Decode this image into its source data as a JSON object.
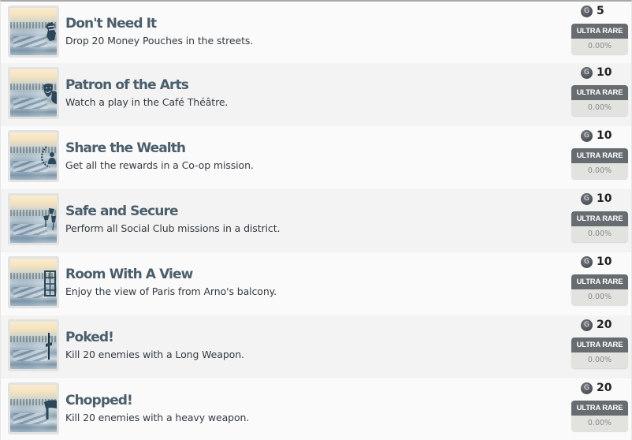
{
  "achievements": [
    {
      "title": "Don't Need It",
      "description": "Drop 20 Money Pouches in the streets.",
      "gamerscore": "5",
      "rarity": "ULTRA RARE",
      "percent": "0.00%",
      "icon": "money-pouch-icon"
    },
    {
      "title": "Patron of the Arts",
      "description": "Watch a play in the Café Théâtre.",
      "gamerscore": "10",
      "rarity": "ULTRA RARE",
      "percent": "0.00%",
      "icon": "theatre-masks-icon"
    },
    {
      "title": "Share the Wealth",
      "description": "Get all the rewards in a Co-op mission.",
      "gamerscore": "10",
      "rarity": "ULTRA RARE",
      "percent": "0.00%",
      "icon": "laurel-figure-icon"
    },
    {
      "title": "Safe and Secure",
      "description": "Perform all Social Club missions in a district.",
      "gamerscore": "10",
      "rarity": "ULTRA RARE",
      "percent": "0.00%",
      "icon": "lanterns-icon"
    },
    {
      "title": "Room With A View",
      "description": "Enjoy the view of Paris from Arno's balcony.",
      "gamerscore": "10",
      "rarity": "ULTRA RARE",
      "percent": "0.00%",
      "icon": "window-icon"
    },
    {
      "title": "Poked!",
      "description": "Kill 20 enemies with a Long Weapon.",
      "gamerscore": "20",
      "rarity": "ULTRA RARE",
      "percent": "0.00%",
      "icon": "long-weapon-icon"
    },
    {
      "title": "Chopped!",
      "description": "Kill 20 enemies with a heavy weapon.",
      "gamerscore": "20",
      "rarity": "ULTRA RARE",
      "percent": "0.00%",
      "icon": "heavy-weapon-icon"
    }
  ],
  "gamerscore_symbol": "G",
  "colors": {
    "title": "#4a5e6c",
    "rarity_badge": "#676c70",
    "rarity_percent_bg": "#e2e3df",
    "row_odd": "#fafafa",
    "row_even": "#f3f3f3"
  }
}
